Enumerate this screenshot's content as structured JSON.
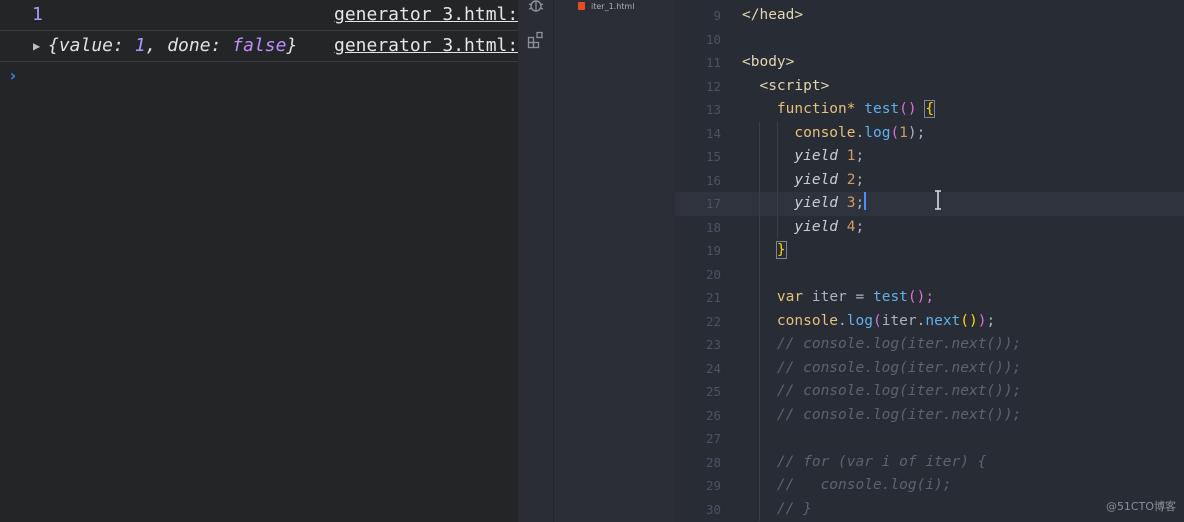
{
  "console": {
    "lines": [
      {
        "value": "1",
        "source": "generator 3.html:"
      },
      {
        "object_open": "{value: ",
        "value_num": "1",
        "sep": ", done: ",
        "value_bool": "false",
        "object_close": "}",
        "source": "generator 3.html:"
      }
    ],
    "prompt": "›"
  },
  "activity_bar": {
    "icons": [
      "bug-icon",
      "extensions-icon"
    ]
  },
  "explorer": {
    "file": "iter_1.html"
  },
  "editor": {
    "line_numbers": [
      "9",
      "10",
      "11",
      "12",
      "13",
      "14",
      "15",
      "16",
      "17",
      "18",
      "19",
      "20",
      "21",
      "22",
      "23",
      "24",
      "25",
      "26",
      "27",
      "28",
      "29",
      "30"
    ],
    "tokens": {
      "l9": "</head>",
      "l11": "<body>",
      "l12": "<script>",
      "l13_kw": "function*",
      "l13_name": "test",
      "l13_paren": "()",
      "l13_brace": "{",
      "l14_obj": "console",
      "l14_dot": ".",
      "l14_fn": "log",
      "l14_open": "(",
      "l14_num": "1",
      "l14_close": ");",
      "yield_kw": "yield",
      "l15_num": "1",
      "l16_num": "2",
      "l17_num": "3",
      "l18_num": "4",
      "semi": ";",
      "l19_brace": "}",
      "l21_var": "var",
      "l21_name": "iter",
      "l21_eq": "=",
      "l21_fn": "test",
      "l21_rest": "();",
      "l22_obj": "console",
      "l22_fn": "log",
      "l22_arg": "iter",
      "l22_next": "next",
      "comment_log": "// console.log(iter.next());",
      "l28": "// for (var i of iter) {",
      "l29": "//   console.log(i);",
      "l30": "// }"
    }
  },
  "watermark": "@51CTO博客",
  "colors": {
    "accent": "#528bff",
    "html_icon": "#e44d26"
  }
}
